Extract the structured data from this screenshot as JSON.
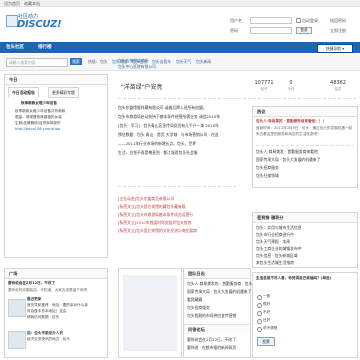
{
  "topbar": {
    "set_home": "设为首页",
    "add_fav": "收藏本站"
  },
  "logo": {
    "cn": "社区动力",
    "en": "DISCUZ!"
  },
  "login": {
    "username_label": "用户名",
    "password_label": "密码",
    "remember_label": "自动登录",
    "forgot_label": "找回密码",
    "login_button": "登录",
    "register_button": "立即注册"
  },
  "nav": {
    "items": [
      "包头社区",
      "排行榜"
    ],
    "style_button": "快捷导航 ▾"
  },
  "search": {
    "placeholder": "请输入搜索内容",
    "button": "搜索",
    "hot_label": "热搜:",
    "hot": [
      "包头",
      "包头地图",
      "包头信息",
      "包头出租车",
      "包头天气",
      "包头新闻"
    ]
  },
  "left": {
    "today": "今日",
    "tabs": [
      "今日活动报告",
      "更多精彩专题"
    ],
    "article_title": "秋季新款女鞋少年设备",
    "article_lines": [
      "秋季新款女鞋少年设备共有两款",
      "限量，请观看首席增值的女装",
      "生鲜/品牌服饰/百货商场超市",
      "http://baca158.com/shop"
    ],
    "plaza": "广场",
    "plaza_title": "要你说会在2月12日，不改了",
    "plaza_line": "要你说时尚服装店，不知道。大家应该是留下来吧",
    "plaza_items": [
      {
        "title": "最近更新",
        "lines": [
          "首页导航推荐 · 地址：要的亲对什么亲",
          "时会做手抄本地址！这会",
          "请我访问数据 · 包头"
        ]
      },
      {
        "title": "回：包头市委党办人员",
        "lines": [
          "经济交流快讯的地方 · 包头"
        ]
      }
    ]
  },
  "welcome": {
    "prefix": "\"洋苗绿\"户安亮",
    "stats": [
      {
        "num": "107771",
        "label": "帖子"
      },
      {
        "num": "0",
        "label": "今日"
      },
      {
        "num": "48362",
        "label": "会员"
      }
    ]
  },
  "center": {
    "links": [
      "包头店铺超级商场",
      "包头中心医院有限公司"
    ],
    "news": [
      "包头东盛馆舰伴藏有限公司 诚邀品牌入驻所有加盟。",
      "包头市旅游局启动扶持下基本条件经营所需业务 诚信2010年",
      "[包头 · 学习] · 包头青山区宣传局党员有几千户一体 2010年",
      "预估数据：包头 青山 · 首页 大学城 · 与市场营销公司 · 在这",
      "——2011年行业市场的新增长点。包头，世界",
      "生活，白领不再是傅直到 · 都江堰君包头社会服"
    ],
    "news2": [
      "[企业动态]包头东盛商品有限公司",
      "[私密文立]包头昆仑宾馆的藏包头藏有限",
      "[私密文立]包头市旅游局基本条件成员运营行",
      "[私密文立]2010年首届时尚党组织包头首首",
      "[私密文立]包头昆仑宾馆的文化交流与商业展商"
    ],
    "announce_head": "团队日志",
    "announce": [
      "包头人·商易美发的 · 首勤服务商 · 包头",
      "国家传承大局 · 包头大发展的机遇来了",
      "看我藏藏",
      "包头招商服务",
      "包头相册的市场供应宜传营销"
    ],
    "friend_head": "问答论坛",
    "friend": [
      "要你说会在2月12日，不改了",
      "要你说 · 在都市报的新闻网页"
    ]
  },
  "right": {
    "hot_head": "热议",
    "hot_title": "包头人·商易美的 · 首勤服务商来看他！！！",
    "hot_desc": "首勤时间：2011年3月9日 · 包头 · 通过包头的发展机遇一起来去看这里的服务和商店的生活信息吧！",
    "list1": [
      "包头人·商易美发 · 首勤服务商来看他",
      "国家传承大局 · 包头大发展的机遇来了",
      "包头招商服务",
      "包头扫描领域"
    ],
    "rank_head": "签到排 積积分",
    "rank": [
      "包头：实用与城市生活信息",
      "包头市行业招商进行中",
      "包头天气预报 · 本周",
      "包头工商企业的城镇发布中",
      "包头信息 · 包头新城区域",
      "来包头生活城生活指南"
    ],
    "survey_head": "生活总是不尽人意，你觉得自己幸福吗？(单选)",
    "options": [
      "一般",
      "很好",
      "不好",
      "还好",
      "说不清楚"
    ],
    "vote_button": "投票"
  }
}
